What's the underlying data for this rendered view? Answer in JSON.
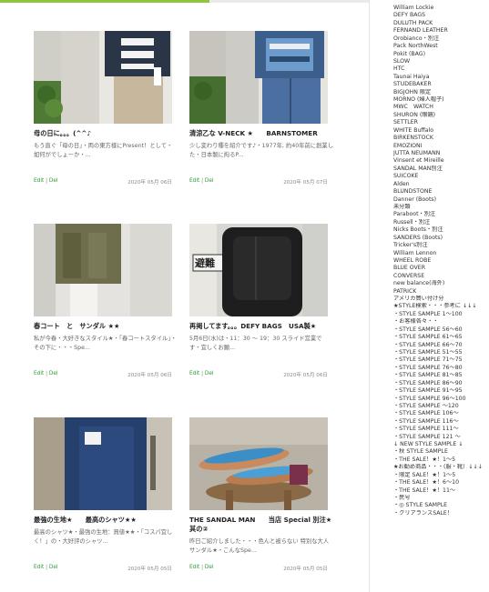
{
  "posts": [
    {
      "title": "母の日に。。。(^^♪",
      "excerpt": "もう直ぐ「母の日」・両の東方様にPresent！として・如何がでしょーか・...",
      "edit": "Edit",
      "del": "Del",
      "date": "2020年 05月 06日"
    },
    {
      "title": "清涼乙な V-NECK ★　　BARNSTOMER",
      "excerpt": "少し変わり種を紹介です♪・1977年, 約40年前に創業した・日本製に拘るP...",
      "edit": "Edit",
      "del": "Del",
      "date": "2020年 05月 07日"
    },
    {
      "title": "春コート　と　サンダル ★★",
      "excerpt": "私が今春・大好きなスタイル★・「春コートスタイル」・その下に・・・Spe...",
      "edit": "Edit",
      "del": "Del",
      "date": "2020年 05月 06日"
    },
    {
      "title": "再掲してます。。。DEFY BAGS　USA製★",
      "excerpt": "5月6日(水)は・11：30 ～ 19：30  スライド営業です・宜しくお願...",
      "edit": "Edit",
      "del": "Del",
      "date": "2020年 05月 06日"
    },
    {
      "title": "最強の生地★　　最高のシャツ★★",
      "excerpt": "最高のシャツ★・最強の生地：買値★★・「コスパ宜しく！」の・大好評のシャツ...",
      "edit": "Edit",
      "del": "Del",
      "date": "2020年 05月 05日"
    },
    {
      "title": "THE SANDAL MAN　　当店 Special 別注★其の②",
      "excerpt": "昨日ご紹介しました・・・色んと被らない 特別な大人サンダル★・こんなSpe...",
      "edit": "Edit",
      "del": "Del",
      "date": "2020年 05月 05日"
    }
  ],
  "sidebar": {
    "items": [
      "William Lockie",
      "DEFY BAGS",
      "DULUTH PACK",
      "FERNAND LEATHER",
      "Orobianco・別注",
      "Pack NorthWest",
      "Pokit (BAG)",
      "SLOW",
      "HTC",
      "Taunai Haiya",
      "STUDEBAKER",
      "BIGJOHN 限定",
      "MORNO (婦人帽子)",
      "MWC　WATCH",
      "SHURON (眼鏡)",
      "SETTLER",
      "WHITE Buffalo",
      "BIRKENSTOCK",
      "EMOZIONI",
      "JUTTA NEUMANN",
      "Vinsent et Mireille",
      "SANDAL MAN別注",
      "SUICOKE",
      "Alden",
      "BLUNDSTONE",
      "Danner (Boots)",
      "未分類",
      "Paraboot・別注",
      "Russell・別注",
      "Nicks Boots・別注",
      "SANDERS (Boots)",
      "Tricker's別注",
      "William Lennon",
      "WHEEL ROBE",
      "BLUE OVER",
      "CONVERSE",
      "new balance(海外)",
      "PATRICK",
      "アメリカ買い付け分",
      "★STYLE検索・・・参考に ↓↓↓",
      "・STYLE SAMPLE 1～100",
      "・お客様各々・・",
      "・STYLE SAMPLE 56～60",
      "・STYLE SAMPLE 61～65",
      "・STYLE SAMPLE 66～70",
      "・STYLE SAMPLE 51～55",
      "・STYLE SAMPLE 71～75",
      "・STYLE SAMPLE 76～80",
      "・STYLE SAMPLE 81～85",
      "・STYLE SAMPLE 86～90",
      "・STYLE SAMPLE 91～95",
      "・STYLE SAMPLE 96～100",
      "・STYLE SAMPLE ～120",
      "・STYLE SAMPLE 106～",
      "・STYLE SAMPLE 116～",
      "・STYLE SAMPLE 111～",
      "・STYLE SAMPLE 121 ～",
      "↓ NEW STYLE SAMPLE ↓",
      "・秋 STYLE SAMPLE",
      "・THE SALE！★！1～5",
      "★お勧め商品・・・(服・靴）↓↓↓",
      "・限定 SALE！★！1～5",
      "・THE SALE！★！6～10",
      "・THE SALE！★！11～",
      "・民号",
      "・◎ STYLE SAMPLE",
      "・クリアランスSALE！"
    ]
  },
  "colors": {
    "link": "#2e9a3a",
    "accent": "#8dc63f"
  }
}
